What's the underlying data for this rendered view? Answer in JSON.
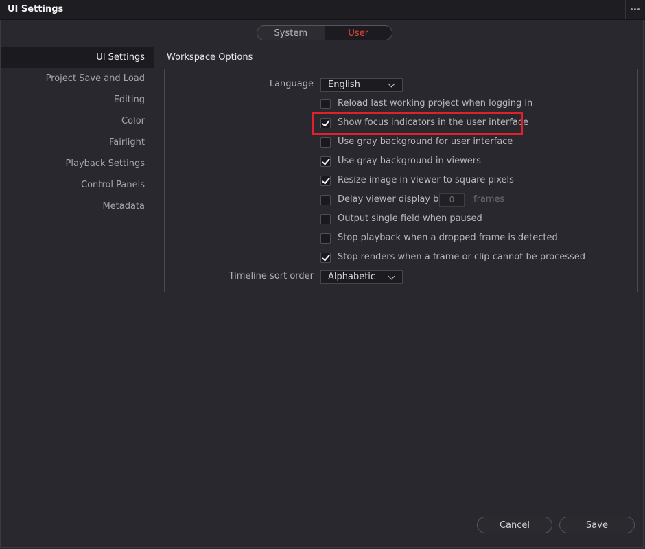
{
  "window": {
    "title": "UI Settings"
  },
  "scope_tabs": [
    {
      "label": "System",
      "active": false
    },
    {
      "label": "User",
      "active": true
    }
  ],
  "sidebar": {
    "items": [
      {
        "label": "UI Settings",
        "active": true
      },
      {
        "label": "Project Save and Load",
        "active": false
      },
      {
        "label": "Editing",
        "active": false
      },
      {
        "label": "Color",
        "active": false
      },
      {
        "label": "Fairlight",
        "active": false
      },
      {
        "label": "Playback Settings",
        "active": false
      },
      {
        "label": "Control Panels",
        "active": false
      },
      {
        "label": "Metadata",
        "active": false
      }
    ]
  },
  "workspace": {
    "title": "Workspace Options",
    "language": {
      "label": "Language",
      "value": "English"
    },
    "options": [
      {
        "label": "Reload last working project when logging in",
        "checked": false
      },
      {
        "label": "Show focus indicators in the user interface",
        "checked": true
      },
      {
        "label": "Use gray background for user interface",
        "checked": false
      },
      {
        "label": "Use gray background in viewers",
        "checked": true
      },
      {
        "label": "Resize image in viewer to square pixels",
        "checked": true
      },
      {
        "label": "Delay viewer display by",
        "checked": false
      },
      {
        "label": "Output single field when paused",
        "checked": false
      },
      {
        "label": "Stop playback when a dropped frame is detected",
        "checked": false
      },
      {
        "label": "Stop renders when a frame or clip cannot be processed",
        "checked": true
      }
    ],
    "delay": {
      "value": "0",
      "units": "frames"
    },
    "timeline_sort": {
      "label": "Timeline sort order",
      "value": "Alphabetic"
    }
  },
  "footer": {
    "cancel_label": "Cancel",
    "save_label": "Save"
  },
  "colors": {
    "accent_active_tab": "#e5443a",
    "highlight_box": "#e0202a",
    "background": "#28282e"
  }
}
